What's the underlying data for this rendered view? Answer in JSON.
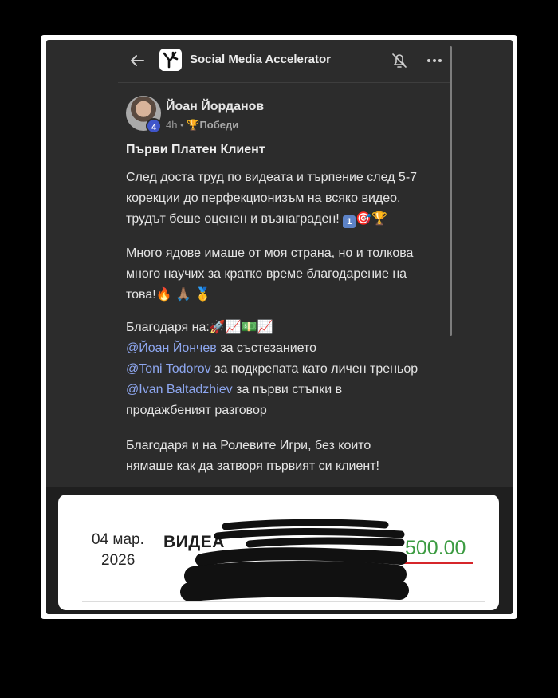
{
  "app": {
    "title": "Social Media Accelerator"
  },
  "post": {
    "author": "Йоан Йорданов",
    "level": "4",
    "time": "4h",
    "category_icon": "🏆",
    "category": "Победи",
    "title": "Първи Платен Клиент",
    "p1": [
      "След доста труд по видеата и търпение след 5-7",
      "корекции до перфекционизъм на всяко видео,",
      "трудът беше оценен и възнаграден!"
    ],
    "p1_emojis": "🎯🏆",
    "p2": [
      "Много ядове имаше от моя страна, но и толкова",
      "много научих за кратко време благодарение на",
      "това!"
    ],
    "p2_emojis": "🔥 🙏🏽 🥇",
    "p3_intro": "Благодаря на:",
    "p3_emojis": "🚀📈💵📈",
    "mentions": [
      {
        "name": "@Йоан Йончев",
        "text": " за състезанието"
      },
      {
        "name": "@Toni Todorov",
        "text": " за подкрепата като личен треньор"
      },
      {
        "name": "@Ivan Baltadzhiev",
        "text": " за първи стъпки в"
      }
    ],
    "p3_tail": "продажбеният разговор",
    "p4": [
      "Благодаря и на Ролевите Игри, без които",
      "нямаше как да затворя първият си клиент!"
    ]
  },
  "receipt": {
    "date_line1": "04 мар.",
    "date_line2": "2026",
    "description": "ВИДЕА",
    "amount": "500.00",
    "amount_color": "#3b9b41"
  },
  "icons": {
    "back": "arrow-left-icon",
    "logo": "app-logo-icon",
    "bell": "bell-off-icon",
    "more": "more-horizontal-icon"
  }
}
